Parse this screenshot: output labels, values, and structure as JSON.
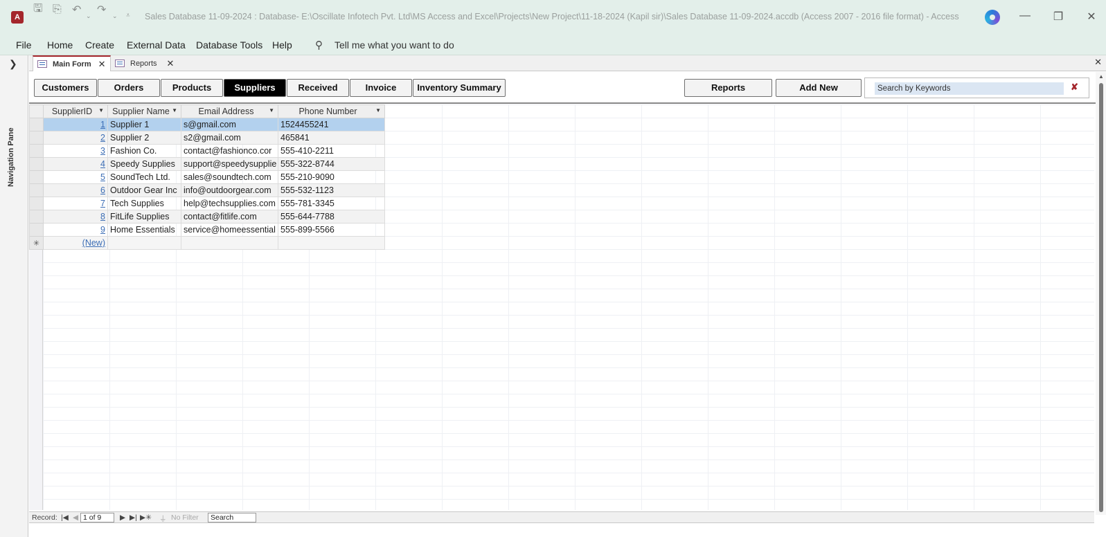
{
  "window": {
    "title": "Sales Database 11-09-2024 : Database- E:\\Oscillate Infotech Pvt. Ltd\\MS Access and Excel\\Projects\\New Project\\11-18-2024 (Kapil sir)\\Sales Database 11-09-2024.accdb (Access 2007 - 2016 file format)  -  Access",
    "app_logo": "A"
  },
  "menu": {
    "items": [
      "File",
      "Home",
      "Create",
      "External Data",
      "Database Tools",
      "Help"
    ],
    "tell_me": "Tell me what you want to do"
  },
  "nav_pane": {
    "label": "Navigation Pane"
  },
  "doc_tabs": [
    {
      "label": "Main Form",
      "active": true
    },
    {
      "label": "Reports",
      "active": false
    }
  ],
  "form": {
    "buttons": [
      "Customers",
      "Orders",
      "Products",
      "Suppliers",
      "Received",
      "Invoice",
      "Inventory Summary"
    ],
    "active_button": "Suppliers",
    "reports_label": "Reports",
    "add_new_label": "Add New",
    "search_placeholder": "Search by Keywords"
  },
  "table": {
    "columns": [
      "SupplierID",
      "Supplier Name",
      "Email Address",
      "Phone Number"
    ],
    "rows": [
      {
        "id": "1",
        "name": "Supplier 1",
        "email": "s@gmail.com",
        "phone": "1524455241"
      },
      {
        "id": "2",
        "name": "Supplier 2",
        "email": "s2@gmail.com",
        "phone": "465841"
      },
      {
        "id": "3",
        "name": "Fashion Co.",
        "email": "contact@fashionco.cor",
        "phone": "555-410-2211"
      },
      {
        "id": "4",
        "name": "Speedy Supplies",
        "email": "support@speedysupplie",
        "phone": "555-322-8744"
      },
      {
        "id": "5",
        "name": "SoundTech Ltd.",
        "email": "sales@soundtech.com",
        "phone": "555-210-9090"
      },
      {
        "id": "6",
        "name": "Outdoor Gear Inc",
        "email": "info@outdoorgear.com",
        "phone": "555-532-1123"
      },
      {
        "id": "7",
        "name": "Tech Supplies",
        "email": "help@techsupplies.com",
        "phone": "555-781-3345"
      },
      {
        "id": "8",
        "name": "FitLife Supplies",
        "email": "contact@fitlife.com",
        "phone": "555-644-7788"
      },
      {
        "id": "9",
        "name": "Home Essentials",
        "email": "service@homeessential",
        "phone": "555-899-5566"
      }
    ],
    "new_row_label": "(New)",
    "new_row_marker": "✳"
  },
  "record_bar": {
    "label": "Record:",
    "position": "1 of 9",
    "filter": "No Filter",
    "search": "Search"
  }
}
